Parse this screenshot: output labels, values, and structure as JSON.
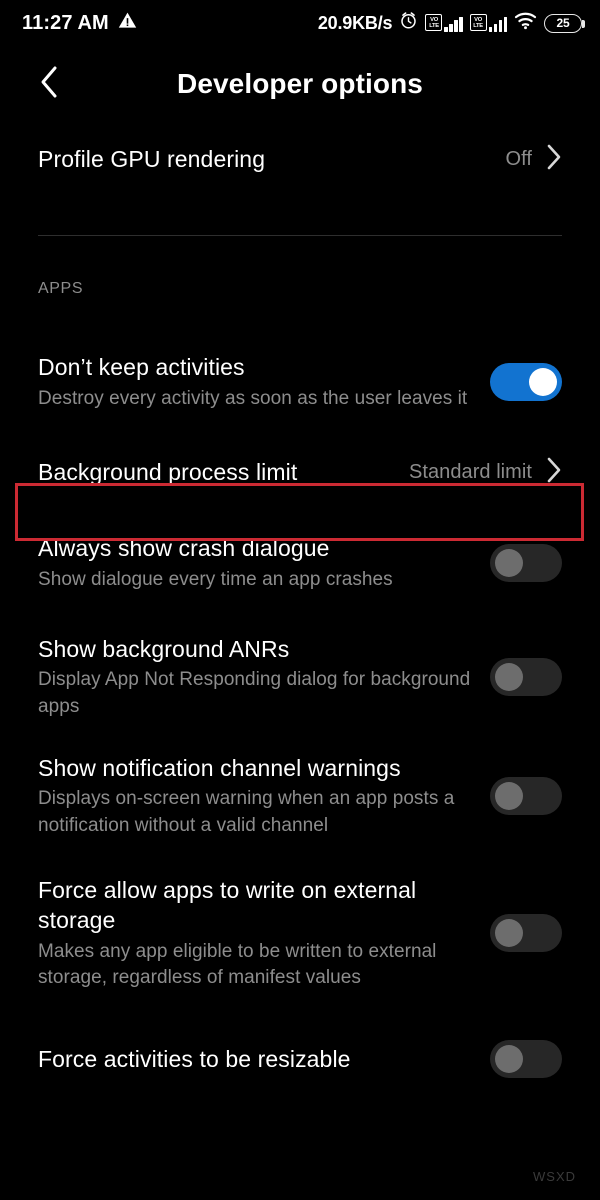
{
  "status_bar": {
    "clock": "11:27 AM",
    "warning_icon": "warning-triangle-icon",
    "network_speed": "20.9KB/s",
    "alarm_icon": "alarm-clock-icon",
    "sim1_label": "VoLTE",
    "sim1_top": "VO",
    "sim1_bottom": "LTE",
    "sim2_label": "VoLTE",
    "sim2_top": "VO",
    "sim2_bottom": "LTE",
    "wifi_icon": "wifi-icon",
    "battery_level": "25"
  },
  "app_bar": {
    "back_icon": "back-chevron-icon",
    "title": "Developer options"
  },
  "colors": {
    "background": "#000000",
    "toggle_on": "#1273d0",
    "toggle_off_track": "#272727",
    "toggle_off_knob": "#6d6d6d",
    "highlight_border": "#cc2a33",
    "secondary_text": "#8d8d8d",
    "divider": "#2e2e2e"
  },
  "sections": {
    "apps_label": "APPS"
  },
  "rows": {
    "profile_gpu": {
      "title": "Profile GPU rendering",
      "value": "Off",
      "chevron": "chevron-right-icon"
    },
    "dont_keep_activities": {
      "title": "Don’t keep activities",
      "subtitle": "Destroy every activity as soon as the user leaves it",
      "toggle_state": "on"
    },
    "background_process_limit": {
      "title": "Background process limit",
      "value": "Standard limit",
      "chevron": "chevron-right-icon",
      "highlighted": "true"
    },
    "always_show_crash_dialogue": {
      "title": "Always show crash dialogue",
      "subtitle": "Show dialogue every time an app crashes",
      "toggle_state": "off"
    },
    "show_background_anrs": {
      "title": "Show background ANRs",
      "subtitle": "Display App Not Responding dialog for background apps",
      "toggle_state": "off"
    },
    "show_notification_channel_warnings": {
      "title": "Show notification channel warnings",
      "subtitle": "Displays on-screen warning when an app posts a notification without a valid channel",
      "toggle_state": "off"
    },
    "force_allow_external_storage": {
      "title": "Force allow apps to write on external storage",
      "subtitle": "Makes any app eligible to be written to external storage, regardless of manifest values",
      "toggle_state": "off"
    },
    "force_activities_resizable": {
      "title": "Force activities to be resizable",
      "toggle_state": "off"
    }
  },
  "watermark": {
    "text": "WSXD"
  }
}
